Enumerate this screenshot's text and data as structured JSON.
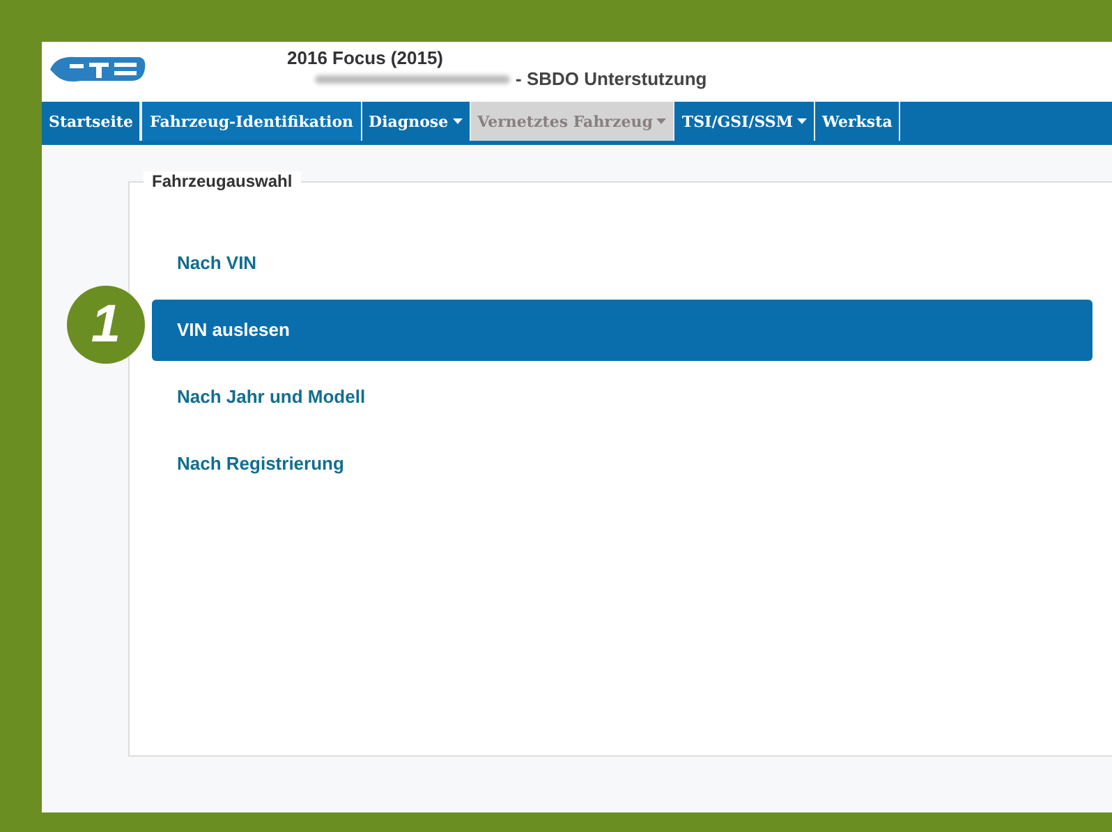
{
  "header": {
    "title": "2016 Focus (2015)",
    "subtitle": "- SBDO Unterstutzung"
  },
  "tabs": [
    {
      "label": "Startseite",
      "selected": false,
      "dropdown": false,
      "disabled": false
    },
    {
      "label": "Fahrzeug-Identifikation",
      "selected": true,
      "dropdown": false,
      "disabled": false
    },
    {
      "label": "Diagnose",
      "selected": false,
      "dropdown": true,
      "disabled": false
    },
    {
      "label": "Vernetztes Fahrzeug",
      "selected": false,
      "dropdown": true,
      "disabled": true
    },
    {
      "label": "TSI/GSI/SSM",
      "selected": false,
      "dropdown": true,
      "disabled": false
    },
    {
      "label": "Werksta",
      "selected": false,
      "dropdown": false,
      "disabled": false
    }
  ],
  "panel": {
    "legend": "Fahrzeugauswahl",
    "items": [
      {
        "label": "Nach VIN",
        "selected": false
      },
      {
        "label": "VIN auslesen",
        "selected": true
      },
      {
        "label": "Nach Jahr und Modell",
        "selected": false
      },
      {
        "label": "Nach Registrierung",
        "selected": false
      }
    ]
  },
  "callout": {
    "label": "1"
  }
}
